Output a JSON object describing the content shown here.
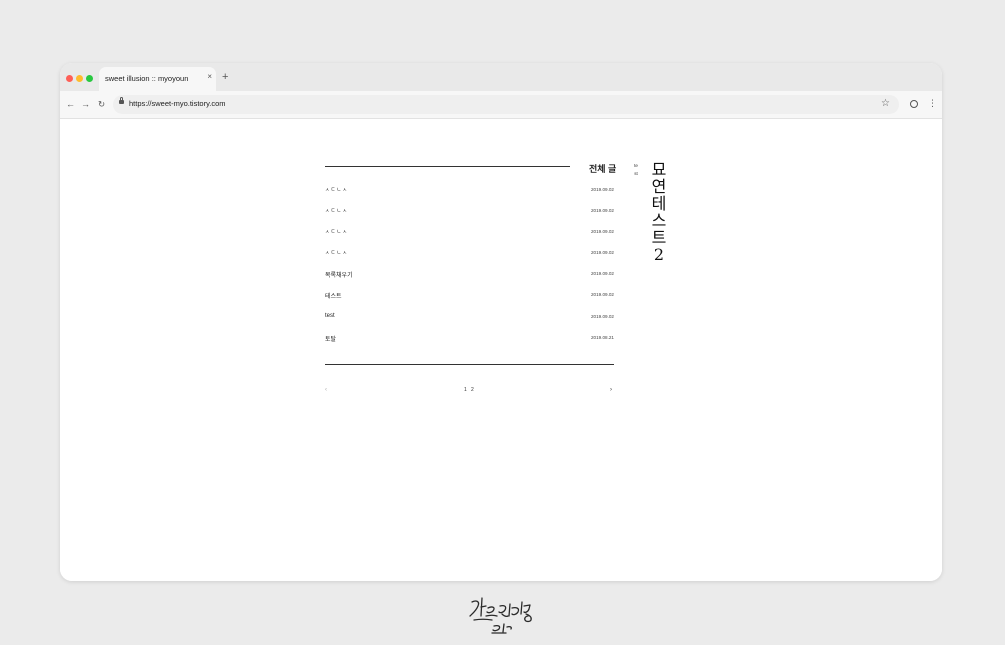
{
  "browser": {
    "tab_title": "sweet illusion :: myoyoun",
    "tab_close": "×",
    "new_tab": "+",
    "url": "https://sweet-myo.tistory.com",
    "nav": {
      "back": "←",
      "forward": "→",
      "reload": "↻",
      "menu": "⋮",
      "star": "☆"
    }
  },
  "page": {
    "list_title": "전체 글",
    "posts": [
      {
        "title": "ㅅㄷㄴㅅ",
        "date": "2019.09.02"
      },
      {
        "title": "ㅅㄷㄴㅅ",
        "date": "2019.09.02"
      },
      {
        "title": "ㅅㄷㄴㅅ",
        "date": "2019.09.02"
      },
      {
        "title": "ㅅㄷㄴㅅ",
        "date": "2019.09.02"
      },
      {
        "title": "목록채우기",
        "date": "2019.09.02"
      },
      {
        "title": "테스트",
        "date": "2019.09.02"
      },
      {
        "title": "test",
        "date": "2019.09.02"
      },
      {
        "title": "토탈",
        "date": "2019.08.21"
      }
    ],
    "pagination": {
      "prev": "‹",
      "pages": [
        "1",
        "2"
      ],
      "next": "›"
    },
    "side_small": "test",
    "blog_title": "묘연테스트2"
  },
  "signature_text": "달콤환상 묘연"
}
